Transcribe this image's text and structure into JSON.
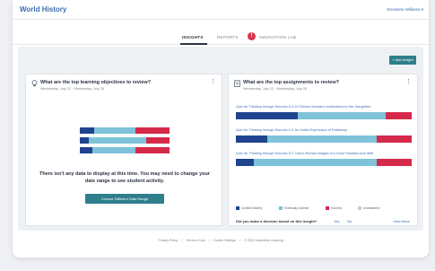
{
  "app": {
    "title": "World History",
    "user": "Ernestine Williams ▾"
  },
  "tabs": [
    {
      "label": "INSIGHTS",
      "active": true
    },
    {
      "label": "REPORTS",
      "active": false
    },
    {
      "label": "INNOVATION LAB",
      "active": false
    }
  ],
  "toolbar": {
    "add_insight_label": "+ Add Insight"
  },
  "objectives_card": {
    "icon": "lightbulb-icon",
    "title": "What are the top learning objectives to review?",
    "date_range": "Wednesday, July 22 - Wednesday, July 26",
    "empty_message": "There isn't any data to display at this time. You may need to change your date range to see student activity.",
    "button_label": "Choose Different Date Range"
  },
  "assignments_card": {
    "icon": "clipboard-icon",
    "title": "What are the top assignments to review?",
    "date_range": "Wednesday, July 22 - Wednesday, July 26",
    "assignments": [
      {
        "label": "Quiz for Thinking through Sources 5.4: A Chinese Woman's Instructions to Her Daughters",
        "distribution": [
          0.35,
          0.5,
          0.15,
          0.0
        ]
      },
      {
        "label": "Quiz for Thinking through Sources 5.3: An Indian Expression of Patriarchy",
        "distribution": [
          0.18,
          0.62,
          0.2,
          0.0
        ]
      },
      {
        "label": "Quiz for Thinking through Sources 5.2: Greco-Roman Images of a Good Husband and Wife",
        "distribution": [
          0.1,
          0.7,
          0.2,
          0.0
        ]
      }
    ],
    "legend": [
      {
        "label": "Content Mastery",
        "color": "#20438f"
      },
      {
        "label": "Eventually Learned",
        "color": "#7ec3da"
      },
      {
        "label": "Incorrect",
        "color": "#d5294a"
      },
      {
        "label": "Unanswered",
        "color": "#c8cdd3"
      }
    ],
    "decision_prompt": "Did you make a decision based on this insight?",
    "yes_label": "Yes",
    "no_label": "No",
    "view_more_label": "View More"
  },
  "footer": {
    "links": [
      "Privacy Policy",
      "Terms of Use",
      "Cookie Settings",
      "© 2022 Macmillan Learning"
    ],
    "separator": "/"
  },
  "colors": {
    "accent": "#2f7e8c",
    "link": "#3d6db0",
    "mastery": "#20438f",
    "learned": "#7ec3da",
    "incorrect": "#d5294a",
    "unanswered": "#c8cdd3"
  }
}
